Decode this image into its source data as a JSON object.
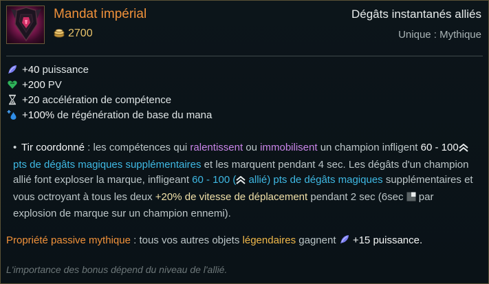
{
  "item": {
    "name": "Mandat impérial",
    "price": "2700",
    "category": "Dégâts instantanés alliés",
    "rarity": "Unique : Mythique",
    "icon": "imperial-mandate-item-icon"
  },
  "stats": [
    {
      "icon": "ability-power-icon",
      "value": "+40",
      "label": "puissance"
    },
    {
      "icon": "health-heart-icon",
      "value": "+200",
      "label": "PV"
    },
    {
      "icon": "hourglass-icon",
      "value": "+20",
      "label": "accélération de compétence"
    },
    {
      "icon": "mana-regen-icon",
      "value": "+100%",
      "label": "de régénération de base du mana"
    }
  ],
  "description": {
    "bullet": "•",
    "name": "Tir coordonné",
    "t1": " : les compétences qui ",
    "k1": "ralentissent",
    "t2": " ou ",
    "k2": "immobilisent",
    "t3": " un champion infligent ",
    "dmg1_range": "60 - 100",
    "dmg1_label": " pts de dégâts magiques supplémentaires",
    "t4": " et les marquent pendant 4 sec. Les dégâts d'un champion allié font exploser la marque, infligeant ",
    "dmg2_range": "60 - 100 (",
    "dmg2_paren": " allié) pts de dégâts magiques",
    "t5": " supplémentaires et vous octroyant à tous les deux ",
    "ms_bonus": "+20% de vitesse de déplacement",
    "t6": " pendant 2 sec (6sec ",
    "t7": " par explosion de marque sur un champion ennemi)."
  },
  "passive": {
    "label": "Propriété passive mythique",
    "t1": " : tous vos autres objets ",
    "legend": "légendaires",
    "t2": " gagnent ",
    "bonus": "+15 puissance."
  },
  "note": "L'importance des bonus dépend du niveau de l'allié.",
  "colors": {
    "title": "#f0913a",
    "purple_keyword": "#c985e8",
    "magic_damage": "#3fb9e4",
    "legendary": "#f0b84a",
    "border": "#5a5236"
  }
}
